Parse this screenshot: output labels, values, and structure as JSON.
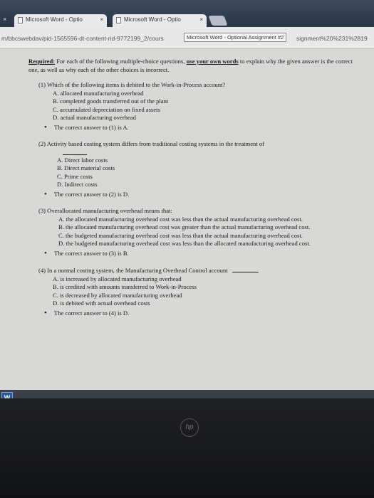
{
  "browser": {
    "tabs": [
      {
        "label": "Microsoft Word - Optio",
        "close": "×"
      },
      {
        "label": "Microsoft Word - Optio",
        "close": "×"
      }
    ],
    "leftClose": "×",
    "url": "m/bbcswebdav/pid-1565596-dt-content-rid-9772199_2/cours",
    "tooltip": "Microsoft Word - Optional Assignment #2",
    "urlTail": "signment%20%231%2819"
  },
  "document": {
    "intro": {
      "required": "Required:",
      "before": " For each of the following multiple-choice questions, ",
      "own": "use your own words",
      "after": " to explain why the given answer is the correct one, as well as why each of the other choices is incorrect."
    },
    "questions": [
      {
        "text": "(1) Which of the following items is debited to the Work-in-Process account?",
        "options": [
          "A. allocated manufacturing overhead",
          "B. completed goods transferred out of the plant",
          "C. accumulated depreciation on fixed assets",
          "D. actual manufacturing overhead"
        ],
        "answer": "The correct answer to (1) is A."
      },
      {
        "text": "(2) Activity based costing system differs from traditional costing systems in the treatment of",
        "options": [
          "A. Direct labor costs",
          "B. Direct material costs",
          "C. Prime costs",
          "D. Indirect costs"
        ],
        "answer": "The correct answer to (2) is D."
      },
      {
        "text": "(3) Overallocated manufacturing overhead means that:",
        "options": [
          "A. the allocated manufacturing overhead cost was less than the actual manufacturing overhead cost.",
          "B. the allocated manufacturing overhead cost was greater than the actual manufacturing overhead cost.",
          "C. the budgeted manufacturing overhead cost was less than the actual manufacturing overhead cost.",
          "D. the budgeted manufacturing overhead cost was less than the allocated manufacturing overhead cost."
        ],
        "answer": "The correct answer to (3) is B."
      },
      {
        "text": "(4) In a normal costing system, the Manufacturing Overhead Control account",
        "options": [
          "A. is increased by allocated manufacturing overhead",
          "B. is credited with amounts transferred to Work-in-Process",
          "C. is decreased by allocated manufacturing overhead",
          "D. is debited with actual overhead costs"
        ],
        "answer": "The correct answer to (4) is D."
      }
    ]
  },
  "taskbar": {
    "word_icon": "W"
  },
  "monitor": {
    "logo": "hp"
  }
}
